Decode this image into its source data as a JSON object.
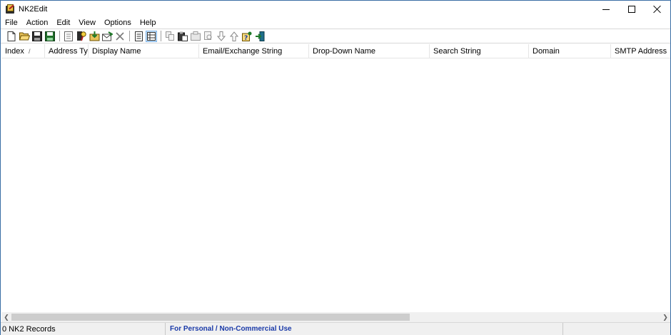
{
  "window": {
    "title": "NK2Edit"
  },
  "menu": {
    "items": [
      "File",
      "Action",
      "Edit",
      "View",
      "Options",
      "Help"
    ]
  },
  "toolbar": {
    "icons": [
      "new-file-icon",
      "open-folder-icon",
      "save-icon",
      "save-as-icon",
      "properties-icon",
      "find-icon",
      "import-icon",
      "email-icon",
      "delete-icon",
      "details-view-icon",
      "grid-view-icon",
      "copy-icon",
      "paste-icon",
      "clipboard-icon",
      "move-icon",
      "move-down-icon",
      "move-up-icon",
      "help-icon",
      "exit-icon"
    ]
  },
  "list": {
    "columns": [
      {
        "label": "Index",
        "width": 61
      },
      {
        "label": "Address Ty...",
        "width": 61
      },
      {
        "label": "Display Name",
        "width": 155
      },
      {
        "label": "Email/Exchange String",
        "width": 154
      },
      {
        "label": "Drop-Down Name",
        "width": 169
      },
      {
        "label": "Search String",
        "width": 139
      },
      {
        "label": "Domain",
        "width": 115
      },
      {
        "label": "SMTP Address",
        "width": 83
      }
    ],
    "sort_indicator": "/",
    "rows": []
  },
  "status": {
    "records": "0 NK2 Records",
    "license": "For Personal / Non-Commercial Use"
  },
  "colors": {
    "license_text": "#1a3aa8",
    "pressed_button": "#cce4f7"
  }
}
